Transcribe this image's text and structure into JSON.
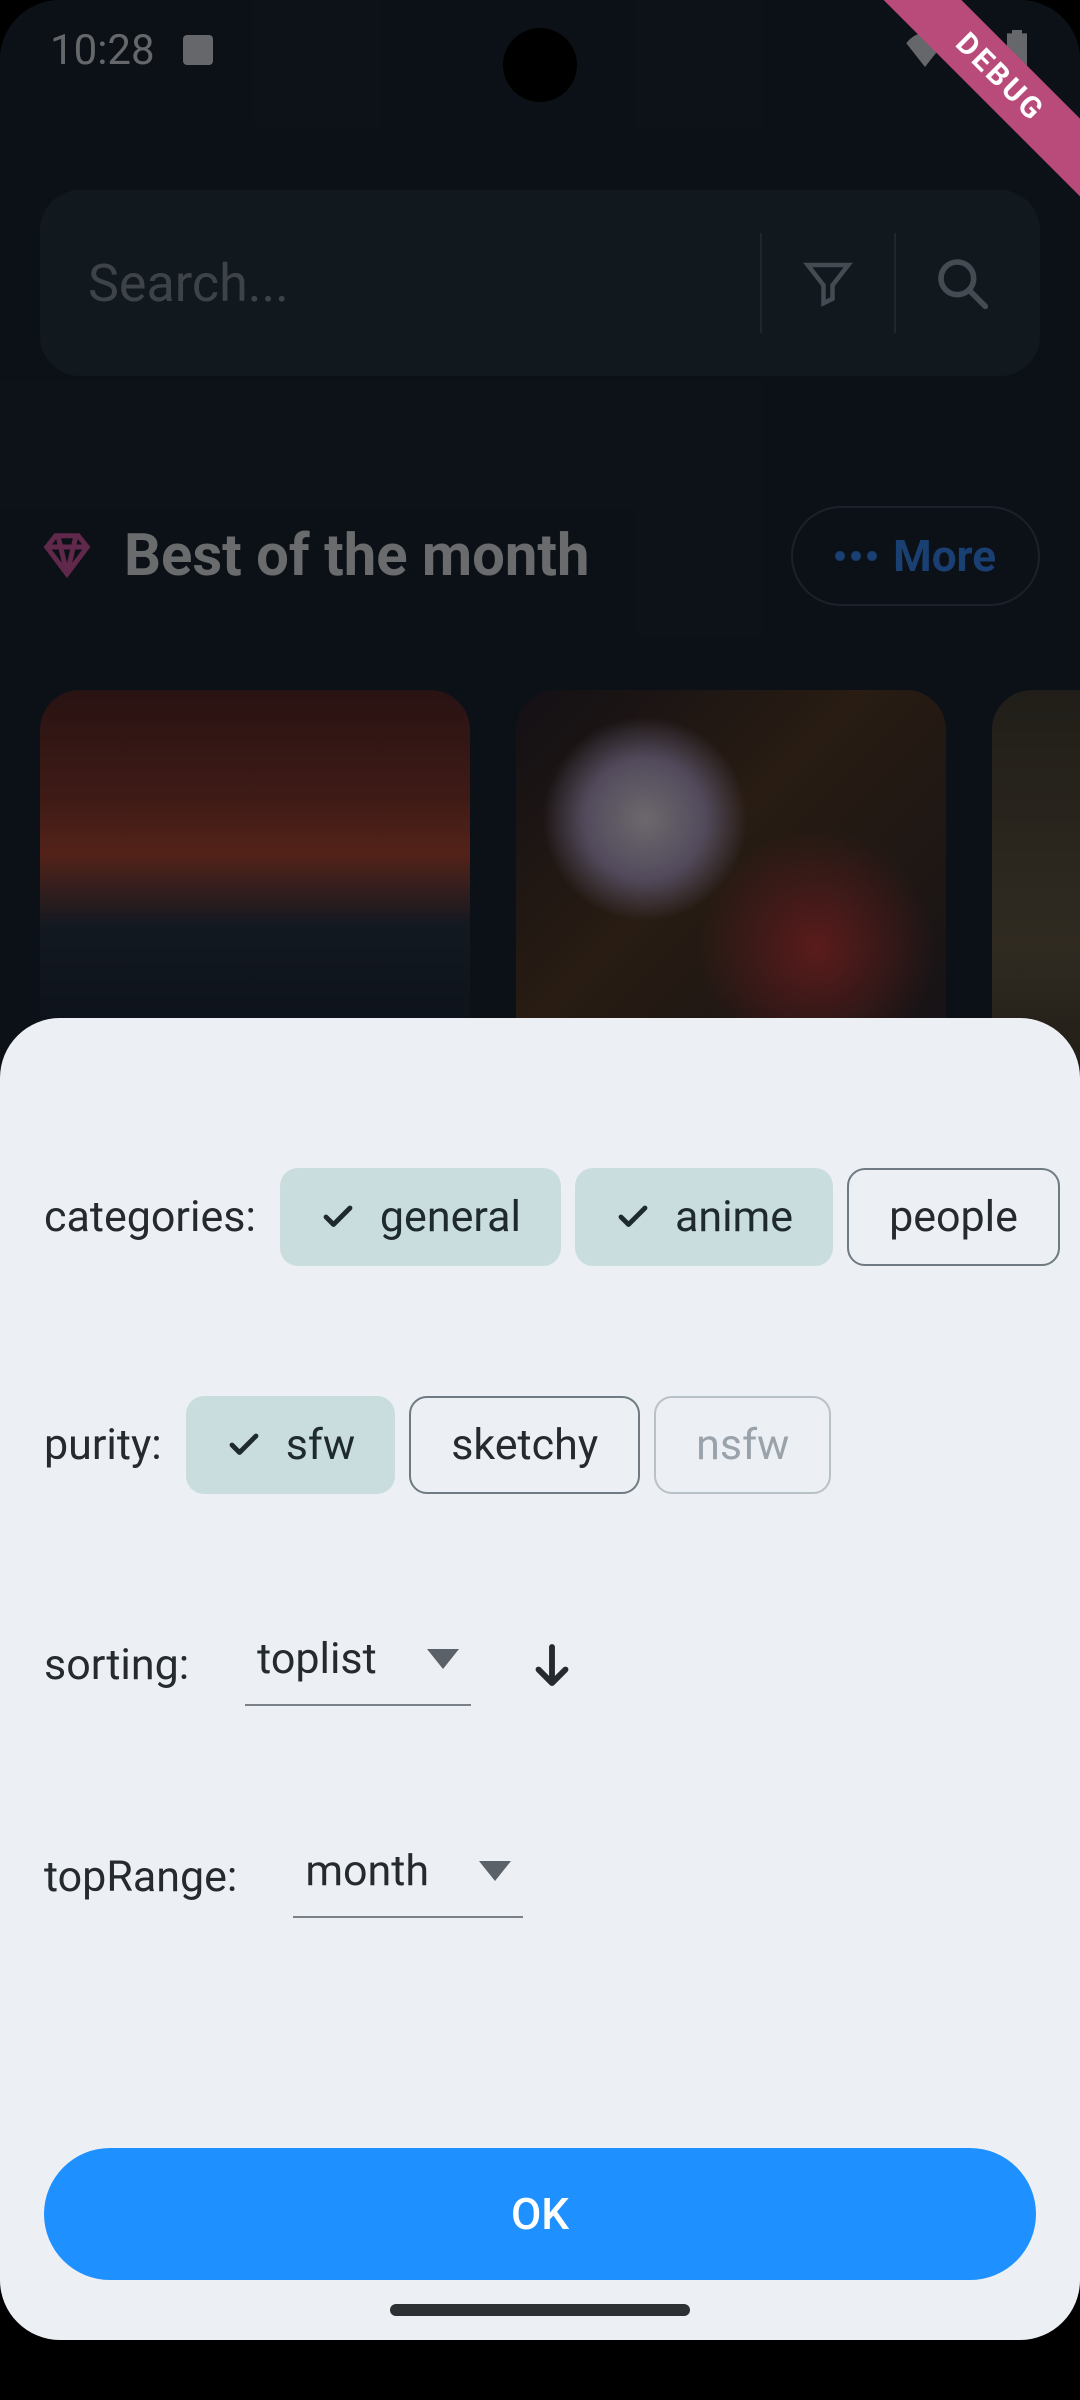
{
  "statusbar": {
    "time": "10:28",
    "debug_label": "DEBUG"
  },
  "search": {
    "placeholder": "Search..."
  },
  "section": {
    "title": "Best of the month",
    "more_label": "More"
  },
  "sheet": {
    "categories": {
      "label": "categories:",
      "items": [
        {
          "key": "general",
          "label": "general",
          "selected": true
        },
        {
          "key": "anime",
          "label": "anime",
          "selected": true
        },
        {
          "key": "people",
          "label": "people",
          "selected": false
        }
      ]
    },
    "purity": {
      "label": "purity:",
      "items": [
        {
          "key": "sfw",
          "label": "sfw",
          "selected": true,
          "disabled": false
        },
        {
          "key": "sketchy",
          "label": "sketchy",
          "selected": false,
          "disabled": false
        },
        {
          "key": "nsfw",
          "label": "nsfw",
          "selected": false,
          "disabled": true
        }
      ]
    },
    "sorting": {
      "label": "sorting:",
      "value": "toplist",
      "direction": "desc"
    },
    "top_range": {
      "label": "topRange:",
      "value": "month"
    },
    "ok_label": "OK"
  }
}
